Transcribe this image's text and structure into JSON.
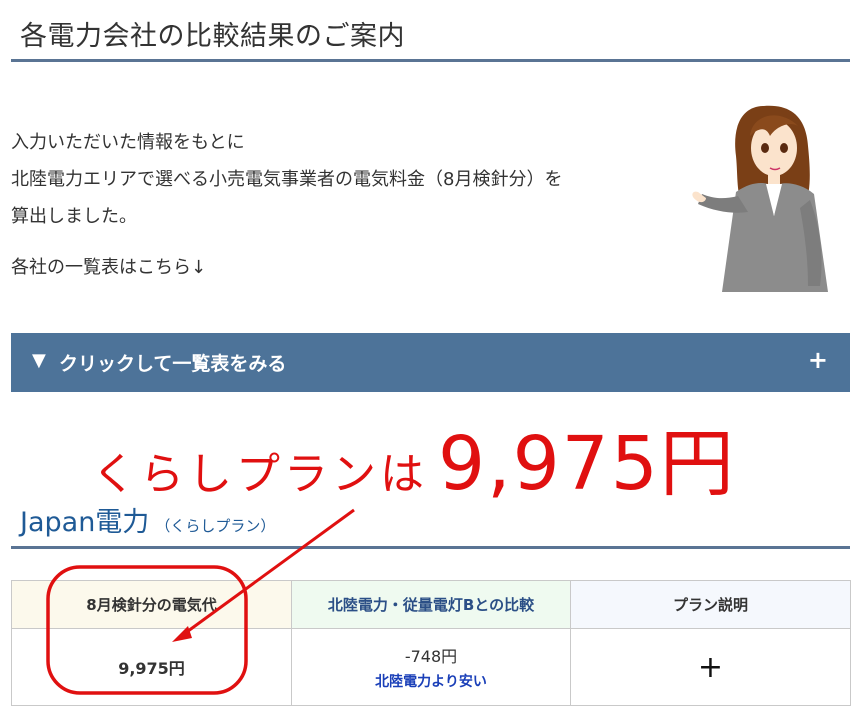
{
  "page_title": "各電力会社の比較結果のご案内",
  "intro": {
    "line1": "入力いただいた情報をもとに",
    "line2": "北陸電力エリアで選べる小売電気事業者の電気料金（8月検針分）を",
    "line3": "算出しました。",
    "note": "各社の一覧表はこちら↓"
  },
  "accordion": {
    "arrow": "▼",
    "label": "クリックして一覧表をみる",
    "toggle": "+"
  },
  "callout": {
    "text": "くらしプランは",
    "price": "9,975円"
  },
  "company": {
    "name": "Japan電力",
    "plan": "（くらしプラン）"
  },
  "table": {
    "headers": [
      "8月検針分の電気代",
      "北陸電力・従量電灯Bとの比較",
      "プラン説明"
    ],
    "cost": "9,975円",
    "diff": "-748円",
    "diff_note": "北陸電力より安い",
    "plan_toggle": "+"
  },
  "colors": {
    "accent_bar": "#4d7399",
    "annotation_red": "#e01010",
    "company_blue": "#1f5a96",
    "savings_blue": "#1a3fb8"
  },
  "icons": {
    "illustration": "presenter-woman-illustration",
    "annotation": "red-arrow-and-circle"
  }
}
